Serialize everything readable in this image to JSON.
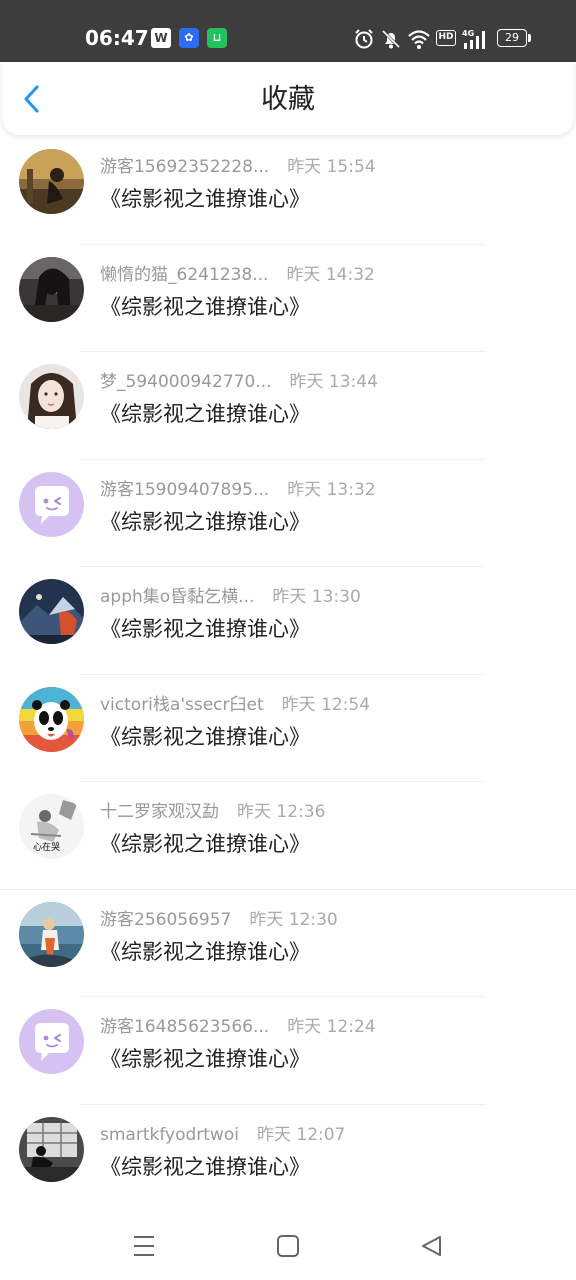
{
  "status_bar": {
    "time": "06:47",
    "icons": [
      "wps-icon",
      "baidu-icon",
      "green-app-icon",
      "alarm-icon",
      "mute-icon",
      "wifi-icon",
      "hd-icon",
      "signal-4g-icon",
      "battery-icon"
    ],
    "hd_label": "HD",
    "network_label": "4G",
    "battery_level": "29"
  },
  "header": {
    "title": "收藏",
    "back_icon": "chevron-left-icon",
    "accent_color": "#2196f3"
  },
  "items": [
    {
      "user": "游客15692352228...",
      "time": "昨天 15:54",
      "title": "《综影视之谁撩谁心》"
    },
    {
      "user": "懒惰的猫_6241238...",
      "time": "昨天 14:32",
      "title": "《综影视之谁撩谁心》"
    },
    {
      "user": "梦_594000942770...",
      "time": "昨天 13:44",
      "title": "《综影视之谁撩谁心》"
    },
    {
      "user": "游客15909407895...",
      "time": "昨天 13:32",
      "title": "《综影视之谁撩谁心》"
    },
    {
      "user": "apph集o昏黏乞横...",
      "time": "昨天 13:30",
      "title": "《综影视之谁撩谁心》"
    },
    {
      "user": "victori栈a'ssecr臼et",
      "time": "昨天 12:54",
      "title": "《综影视之谁撩谁心》"
    },
    {
      "user": "十二罗家观汉勐",
      "time": "昨天 12:36",
      "title": "《综影视之谁撩谁心》"
    },
    {
      "user": "游客256056957",
      "time": "昨天 12:30",
      "title": "《综影视之谁撩谁心》"
    },
    {
      "user": "游客16485623566...",
      "time": "昨天 12:24",
      "title": "《综影视之谁撩谁心》"
    },
    {
      "user": "smartkfyodrtwoi",
      "time": "昨天 12:07",
      "title": "《综影视之谁撩谁心》"
    }
  ],
  "nav_bar": {
    "icons": [
      "menu-icon",
      "home-square-icon",
      "back-triangle-icon"
    ]
  }
}
